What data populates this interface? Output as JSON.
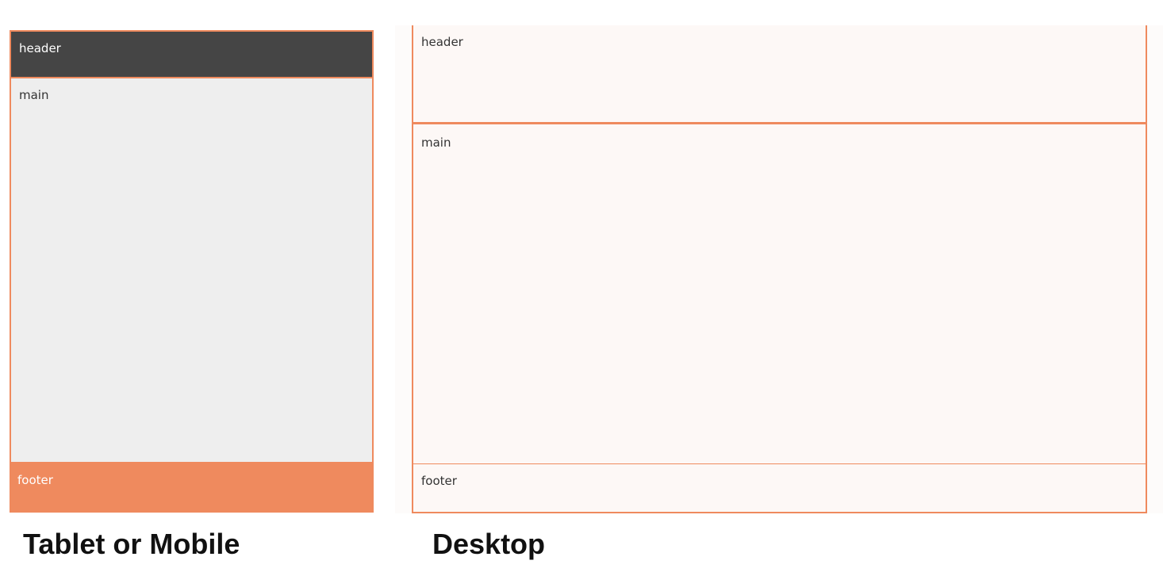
{
  "mobile": {
    "header": "header",
    "main": "main",
    "footer": "footer",
    "caption": "Tablet or Mobile"
  },
  "desktop": {
    "header": "header",
    "main": "main",
    "footer": "footer",
    "caption": "Desktop"
  },
  "colors": {
    "accent": "#ef8a5e",
    "dark_header": "#454545",
    "light_body": "#eeeeee",
    "desktop_fill": "#fdf8f6"
  }
}
